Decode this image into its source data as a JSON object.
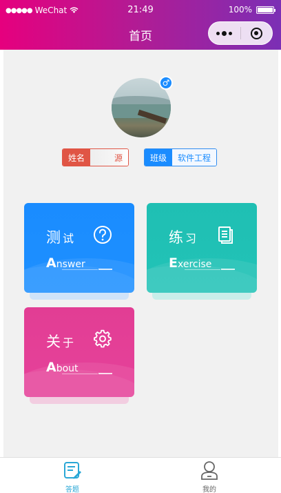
{
  "status": {
    "carrier": "WeChat",
    "time": "21:49",
    "battery": "100%"
  },
  "nav": {
    "title": "首页"
  },
  "profile": {
    "gender_symbol": "♂",
    "name_key": "姓名",
    "name_value": "源",
    "class_key": "班级",
    "class_value": "软件工程"
  },
  "cards": {
    "answer": {
      "title_a": "测",
      "title_b": "试",
      "sub_big": "A",
      "sub_rest": "nswer"
    },
    "exercise": {
      "title_a": "练",
      "title_b": "习",
      "sub_big": "E",
      "sub_rest": "xercise"
    },
    "about": {
      "title_a": "关",
      "title_b": "于",
      "sub_big": "A",
      "sub_rest": "bout"
    }
  },
  "tabbar": {
    "answer_label": "答题",
    "mine_label": "我的"
  },
  "colors": {
    "header_start": "#e6007e",
    "header_end": "#7b2fb5",
    "answer": "#1a8cff",
    "exercise": "#1fbfb3",
    "about": "#e23d94",
    "tab_active": "#29a7d6"
  }
}
